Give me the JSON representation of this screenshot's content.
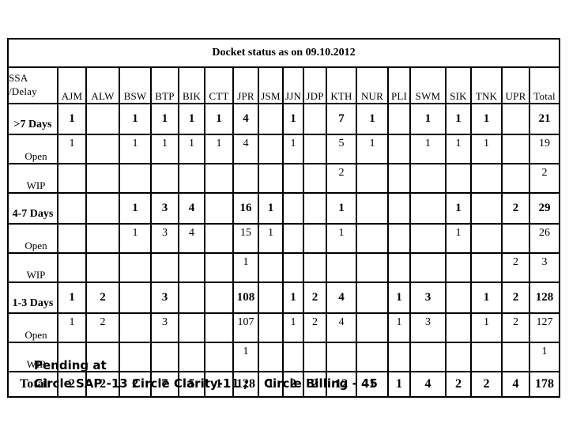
{
  "title": "Docket status as on 09.10.2012",
  "corner_label_line1": "SSA",
  "corner_label_line2": "/Delay",
  "columns": [
    "AJM",
    "ALW",
    "BSW",
    "BTP",
    "BIK",
    "CTT",
    "JPR",
    "JSM",
    "JJN",
    "JDP",
    "KTH",
    "NUR",
    "PLI",
    "SWM",
    "SIK",
    "TNK",
    "UPR",
    "Total"
  ],
  "rows": [
    {
      "label": ">7 Days",
      "type": "grp",
      "values": [
        "1",
        "",
        "1",
        "1",
        "1",
        "1",
        "4",
        "",
        "1",
        "",
        "7",
        "1",
        "",
        "1",
        "1",
        "1",
        "",
        "21"
      ]
    },
    {
      "label": "Open",
      "type": "sub",
      "values": [
        "1",
        "",
        "1",
        "1",
        "1",
        "1",
        "4",
        "",
        "1",
        "",
        "5",
        "1",
        "",
        "1",
        "1",
        "1",
        "",
        "19"
      ]
    },
    {
      "label": "WIP",
      "type": "sub",
      "values": [
        "",
        "",
        "",
        "",
        "",
        "",
        "",
        "",
        "",
        "",
        "2",
        "",
        "",
        "",
        "",
        "",
        "",
        "2"
      ]
    },
    {
      "label": "4-7 Days",
      "type": "grp",
      "values": [
        "",
        "",
        "1",
        "3",
        "4",
        "",
        "16",
        "1",
        "",
        "",
        "1",
        "",
        "",
        "",
        "1",
        "",
        "2",
        "29"
      ]
    },
    {
      "label": "Open",
      "type": "sub",
      "values": [
        "",
        "",
        "1",
        "3",
        "4",
        "",
        "15",
        "1",
        "",
        "",
        "1",
        "",
        "",
        "",
        "1",
        "",
        "",
        "26"
      ]
    },
    {
      "label": "WIP",
      "type": "sub",
      "values": [
        "",
        "",
        "",
        "",
        "",
        "",
        "1",
        "",
        "",
        "",
        "",
        "",
        "",
        "",
        "",
        "",
        "2",
        "3"
      ]
    },
    {
      "label": "1-3 Days",
      "type": "grp",
      "values": [
        "1",
        "2",
        "",
        "3",
        "",
        "",
        "108",
        "",
        "1",
        "2",
        "4",
        "",
        "1",
        "3",
        "",
        "1",
        "2",
        "128"
      ]
    },
    {
      "label": "Open",
      "type": "sub",
      "values": [
        "1",
        "2",
        "",
        "3",
        "",
        "",
        "107",
        "",
        "1",
        "2",
        "4",
        "",
        "1",
        "3",
        "",
        "1",
        "2",
        "127"
      ]
    },
    {
      "label": "WIP",
      "type": "sub",
      "values": [
        "",
        "",
        "",
        "",
        "",
        "",
        "1",
        "",
        "",
        "",
        "",
        "",
        "",
        "",
        "",
        "",
        "",
        "1"
      ]
    },
    {
      "label": "Total",
      "type": "tot",
      "values": [
        "2",
        "2",
        "2",
        "7",
        "5",
        "1",
        "128",
        "1",
        "2",
        "2",
        "12",
        "1",
        "1",
        "4",
        "2",
        "2",
        "4",
        "178"
      ]
    }
  ],
  "note": {
    "line1": "Pending at",
    "line2_part1": "Circle SAP -13 Circle Clarity-11 ;",
    "line2_part2": "Circle Billing - 45"
  }
}
